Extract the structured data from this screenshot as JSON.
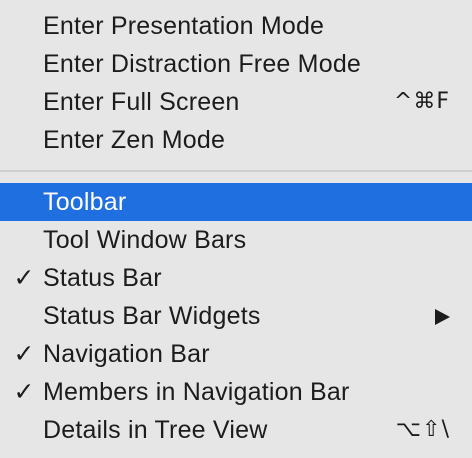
{
  "menu": {
    "group1": [
      {
        "label": "Enter Presentation Mode",
        "checked": false,
        "shortcut": ""
      },
      {
        "label": "Enter Distraction Free Mode",
        "checked": false,
        "shortcut": ""
      },
      {
        "label": "Enter Full Screen",
        "checked": false,
        "shortcut": "^⌘F"
      },
      {
        "label": "Enter Zen Mode",
        "checked": false,
        "shortcut": ""
      }
    ],
    "group2": [
      {
        "label": "Toolbar",
        "checked": false,
        "highlighted": true,
        "shortcut": ""
      },
      {
        "label": "Tool Window Bars",
        "checked": false,
        "shortcut": ""
      },
      {
        "label": "Status Bar",
        "checked": true,
        "shortcut": ""
      },
      {
        "label": "Status Bar Widgets",
        "checked": false,
        "submenu": true,
        "shortcut": ""
      },
      {
        "label": "Navigation Bar",
        "checked": true,
        "shortcut": ""
      },
      {
        "label": "Members in Navigation Bar",
        "checked": true,
        "shortcut": ""
      },
      {
        "label": "Details in Tree View",
        "checked": false,
        "shortcut": "⌥⇧\\"
      }
    ],
    "check_glyph": "✓",
    "colors": {
      "background": "#e6e6e6",
      "highlight": "#1f6fe0",
      "text": "#1c1c1c",
      "separator": "#cfcfcf"
    }
  }
}
